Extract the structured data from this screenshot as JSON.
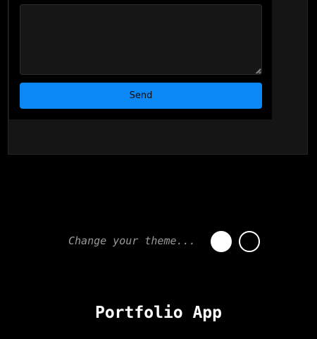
{
  "contact_form": {
    "message_value": "",
    "send_label": "Send"
  },
  "theme": {
    "label": "Change your theme...",
    "options": [
      {
        "name": "light",
        "color": "#ffffff"
      },
      {
        "name": "dark",
        "color": "#000000"
      }
    ]
  },
  "footer": {
    "title": "Portfolio App"
  },
  "colors": {
    "accent": "#0a88f6",
    "background": "#000000",
    "panel": "#151515"
  }
}
